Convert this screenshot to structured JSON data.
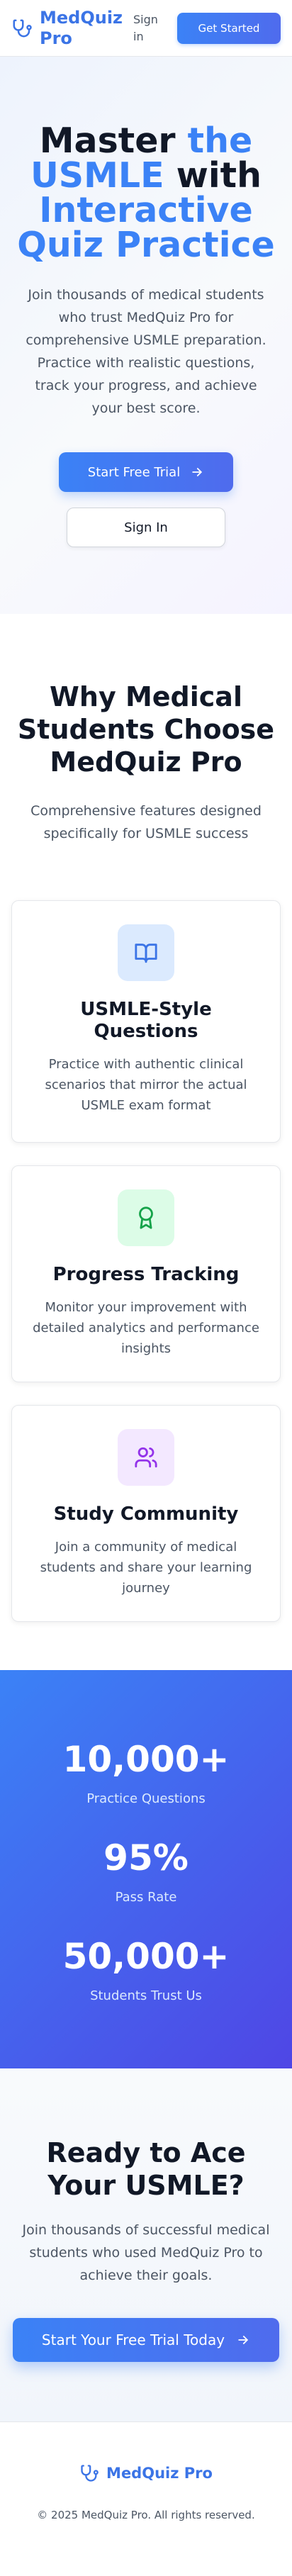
{
  "header": {
    "brand": "MedQuiz Pro",
    "signin_label": "Sign in",
    "get_started_label": "Get Started"
  },
  "hero": {
    "title_line1_dark": "Master",
    "title_line1_blue": "the",
    "title_line2_blue": "USMLE",
    "title_line2_dark": "with",
    "title_line3_blue": "Interactive",
    "title_line4_blue": "Quiz Practice",
    "subtitle": "Join thousands of medical students who trust MedQuiz Pro for comprehensive USMLE preparation. Practice with realistic questions, track your progress, and achieve your best score.",
    "primary_cta": "Start Free Trial",
    "secondary_cta": "Sign In"
  },
  "features": {
    "title": "Why Medical Students Choose MedQuiz Pro",
    "subtitle": "Comprehensive features designed specifically for USMLE success",
    "cards": [
      {
        "icon": "book-open-icon",
        "title": "USMLE-Style Questions",
        "description": "Practice with authentic clinical scenarios that mirror the actual USMLE exam format"
      },
      {
        "icon": "award-icon",
        "title": "Progress Tracking",
        "description": "Monitor your improvement with detailed analytics and performance insights"
      },
      {
        "icon": "users-icon",
        "title": "Study Community",
        "description": "Join a community of medical students and share your learning journey"
      }
    ]
  },
  "stats": [
    {
      "value": "10,000+",
      "label": "Practice Questions"
    },
    {
      "value": "95%",
      "label": "Pass Rate"
    },
    {
      "value": "50,000+",
      "label": "Students Trust Us"
    }
  ],
  "cta": {
    "title": "Ready to Ace Your USMLE?",
    "subtitle": "Join thousands of successful medical students who used MedQuiz Pro to achieve their goals.",
    "button": "Start Your Free Trial Today"
  },
  "footer": {
    "brand": "MedQuiz Pro",
    "copyright": "© 2025 MedQuiz Pro. All rights reserved."
  },
  "colors": {
    "accent": "#3b82f6",
    "accent_dark": "#4f46e5",
    "text": "#111827",
    "muted": "#4b5563"
  }
}
